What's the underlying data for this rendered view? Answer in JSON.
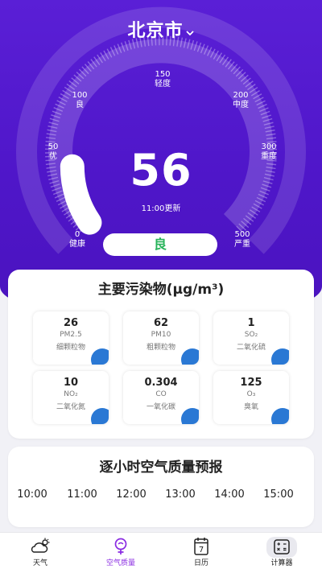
{
  "city": {
    "name": "北京市"
  },
  "gauge": {
    "ticks": [
      {
        "value": "0",
        "label": "健康"
      },
      {
        "value": "50",
        "label": "优"
      },
      {
        "value": "100",
        "label": "良"
      },
      {
        "value": "150",
        "label": "轻度"
      },
      {
        "value": "200",
        "label": "中度"
      },
      {
        "value": "300",
        "label": "重度"
      },
      {
        "value": "500",
        "label": "严重"
      }
    ],
    "aqi": "56",
    "updated": "11:00更新",
    "level": "良",
    "level_color": "#27b35a"
  },
  "pollutants": {
    "title": "主要污染物(μg/m³)",
    "items": [
      {
        "value": "26",
        "code": "PM2.5",
        "name": "细颗粒物"
      },
      {
        "value": "62",
        "code": "PM10",
        "name": "粗颗粒物"
      },
      {
        "value": "1",
        "code": "SO₂",
        "name": "二氧化硫"
      },
      {
        "value": "10",
        "code": "NO₂",
        "name": "二氧化氮"
      },
      {
        "value": "0.304",
        "code": "CO",
        "name": "一氧化碳"
      },
      {
        "value": "125",
        "code": "O₃",
        "name": "臭氧"
      }
    ]
  },
  "hourly": {
    "title": "逐小时空气质量预报",
    "hours": [
      "10:00",
      "11:00",
      "12:00",
      "13:00",
      "14:00",
      "15:00"
    ]
  },
  "nav": {
    "items": [
      {
        "label": "天气",
        "icon": "weather-icon"
      },
      {
        "label": "空气质量",
        "icon": "air-quality-icon"
      },
      {
        "label": "日历",
        "icon": "calendar-icon",
        "day": "7"
      },
      {
        "label": "计算器",
        "icon": "calculator-icon"
      }
    ],
    "active_color": "#8a2be2"
  },
  "colors": {
    "hero": "#5a1fd6",
    "tile_accent": "#2a78d4"
  }
}
